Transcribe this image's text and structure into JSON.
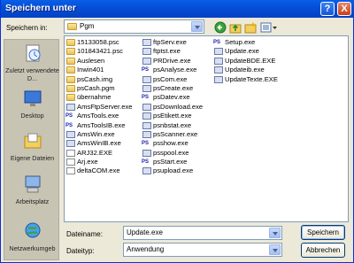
{
  "dialog": {
    "title": "Speichern unter"
  },
  "save_in": {
    "label": "Speichern in:",
    "value": "Pgm"
  },
  "places": [
    {
      "label": "Zuletzt verwendete D...",
      "icon": "recent-documents-icon"
    },
    {
      "label": "Desktop",
      "icon": "desktop-icon"
    },
    {
      "label": "Eigene Dateien",
      "icon": "my-documents-icon"
    },
    {
      "label": "Arbeitsplatz",
      "icon": "my-computer-icon"
    },
    {
      "label": "Netzwerkumgeb",
      "icon": "network-icon"
    }
  ],
  "files": {
    "col1": [
      {
        "name": "15133058.psc",
        "kind": "folder"
      },
      {
        "name": "101843421.psc",
        "kind": "folder"
      },
      {
        "name": "Auslesen",
        "kind": "folder"
      },
      {
        "name": "Inwin401",
        "kind": "folder"
      },
      {
        "name": "psCash.img",
        "kind": "folder"
      },
      {
        "name": "psCash.pgm",
        "kind": "folder"
      },
      {
        "name": "übernahme",
        "kind": "folder"
      },
      {
        "name": "AmsFtpServer.exe",
        "kind": "exe"
      },
      {
        "name": "AmsTools.exe",
        "kind": "ps"
      },
      {
        "name": "AmsToolsIB.exe",
        "kind": "ps"
      },
      {
        "name": "AmsWin.exe",
        "kind": "exe"
      },
      {
        "name": "AmsWinIB.exe",
        "kind": "exe"
      },
      {
        "name": "ARJ32.EXE",
        "kind": "doc"
      },
      {
        "name": "Arj.exe",
        "kind": "doc"
      },
      {
        "name": "deltaCOM.exe",
        "kind": "doc"
      }
    ],
    "col2": [
      {
        "name": "ftpServ.exe",
        "kind": "exe"
      },
      {
        "name": "ftptst.exe",
        "kind": "exe"
      },
      {
        "name": "PRDrive.exe",
        "kind": "exe"
      },
      {
        "name": "psAnalyse.exe",
        "kind": "ps"
      },
      {
        "name": "psCom.exe",
        "kind": "exe"
      },
      {
        "name": "psCreate.exe",
        "kind": "exe"
      },
      {
        "name": "psDatev.exe",
        "kind": "ps"
      },
      {
        "name": "psDownload.exe",
        "kind": "exe"
      },
      {
        "name": "psEtikett.exe",
        "kind": "exe"
      },
      {
        "name": "psnbstat.exe",
        "kind": "exe"
      },
      {
        "name": "psScanner.exe",
        "kind": "exe"
      },
      {
        "name": "psshow.exe",
        "kind": "ps"
      },
      {
        "name": "psspool.exe",
        "kind": "exe"
      },
      {
        "name": "psStart.exe",
        "kind": "ps"
      },
      {
        "name": "psupload.exe",
        "kind": "exe"
      }
    ],
    "col3": [
      {
        "name": "Setup.exe",
        "kind": "ps"
      },
      {
        "name": "Update.exe",
        "kind": "exe"
      },
      {
        "name": "UpdateBDE.EXE",
        "kind": "exe"
      },
      {
        "name": "Updateib.exe",
        "kind": "exe"
      },
      {
        "name": "UpdateTexte.EXE",
        "kind": "exe"
      }
    ]
  },
  "filename": {
    "label": "Dateiname:",
    "value": "Update.exe"
  },
  "filetype": {
    "label": "Dateityp:",
    "value": "Anwendung"
  },
  "buttons": {
    "save": "Speichern",
    "cancel": "Abbrechen"
  },
  "window_buttons": {
    "help": "?",
    "close": "X"
  }
}
